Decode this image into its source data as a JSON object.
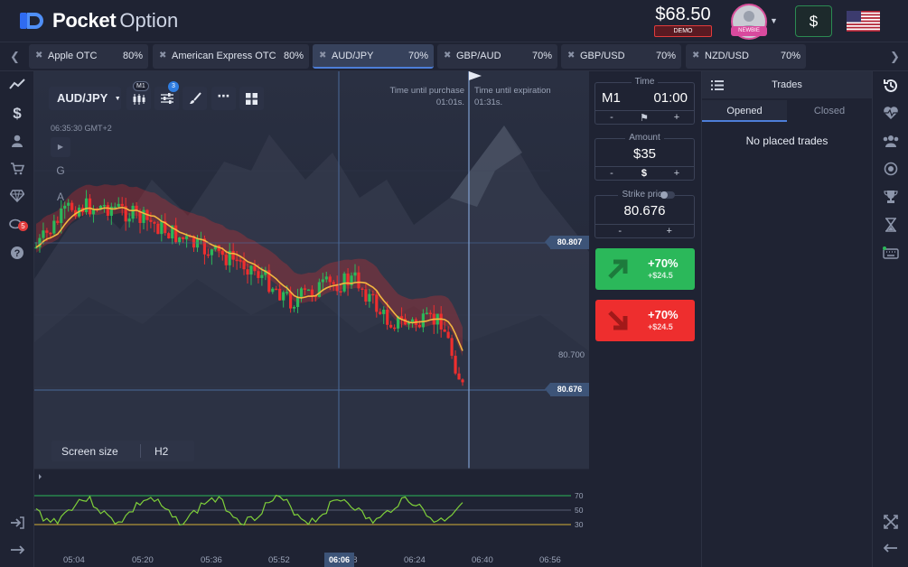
{
  "header": {
    "brand_bold": "Pocket",
    "brand_light": "Option",
    "balance": "$68.50",
    "account_type": "DEMO",
    "user_level": "NEWBIE",
    "deposit_label": "$"
  },
  "tabs": [
    {
      "name": "Apple OTC",
      "payout": "80%"
    },
    {
      "name": "American Express OTC",
      "payout": "80%"
    },
    {
      "name": "AUD/JPY",
      "payout": "70%",
      "active": true
    },
    {
      "name": "GBP/AUD",
      "payout": "70%"
    },
    {
      "name": "GBP/USD",
      "payout": "70%"
    },
    {
      "name": "NZD/USD",
      "payout": "70%"
    }
  ],
  "chart": {
    "asset": "AUD/JPY",
    "timeframe_badge": "M1",
    "indicator_badge": "3",
    "server_time": "06:35:30 GMT+2",
    "side_g": "G",
    "side_a": "A",
    "purchase_label": "Time until purchase",
    "purchase_value": "01:01s.",
    "expiration_label": "Time until expiration",
    "expiration_value": "01:31s.",
    "price_high_tag": "80.807",
    "price_current_tag": "80.676",
    "price_axis_label": "80.700",
    "screen_size_label": "Screen size",
    "screen_size_value": "H2",
    "oscillator_levels": [
      "70",
      "50",
      "30"
    ],
    "time_labels": [
      "05:04",
      "05:20",
      "05:36",
      "05:52",
      "06:06",
      "6:08",
      "06:24",
      "06:40",
      "06:56"
    ],
    "time_now": "06:06"
  },
  "trade": {
    "time_label": "Time",
    "timeframe": "M1",
    "time_value": "01:00",
    "amount_label": "Amount",
    "amount_value": "$35",
    "amount_currency": "$",
    "strike_label": "Strike price",
    "strike_value": "80.676",
    "minus": "-",
    "plus": "+",
    "up_pct": "+70%",
    "up_gain": "+$24.5",
    "down_pct": "+70%",
    "down_gain": "+$24.5"
  },
  "trades_panel": {
    "title": "Trades",
    "tab_opened": "Opened",
    "tab_closed": "Closed",
    "empty_message": "No placed trades"
  },
  "colors": {
    "up": "#2bb85a",
    "down": "#ee2e2e",
    "accent": "#4d7ed8",
    "ma": "#f4b63f",
    "oscillator": "#7fd03a"
  },
  "sidebar_badge": "5"
}
